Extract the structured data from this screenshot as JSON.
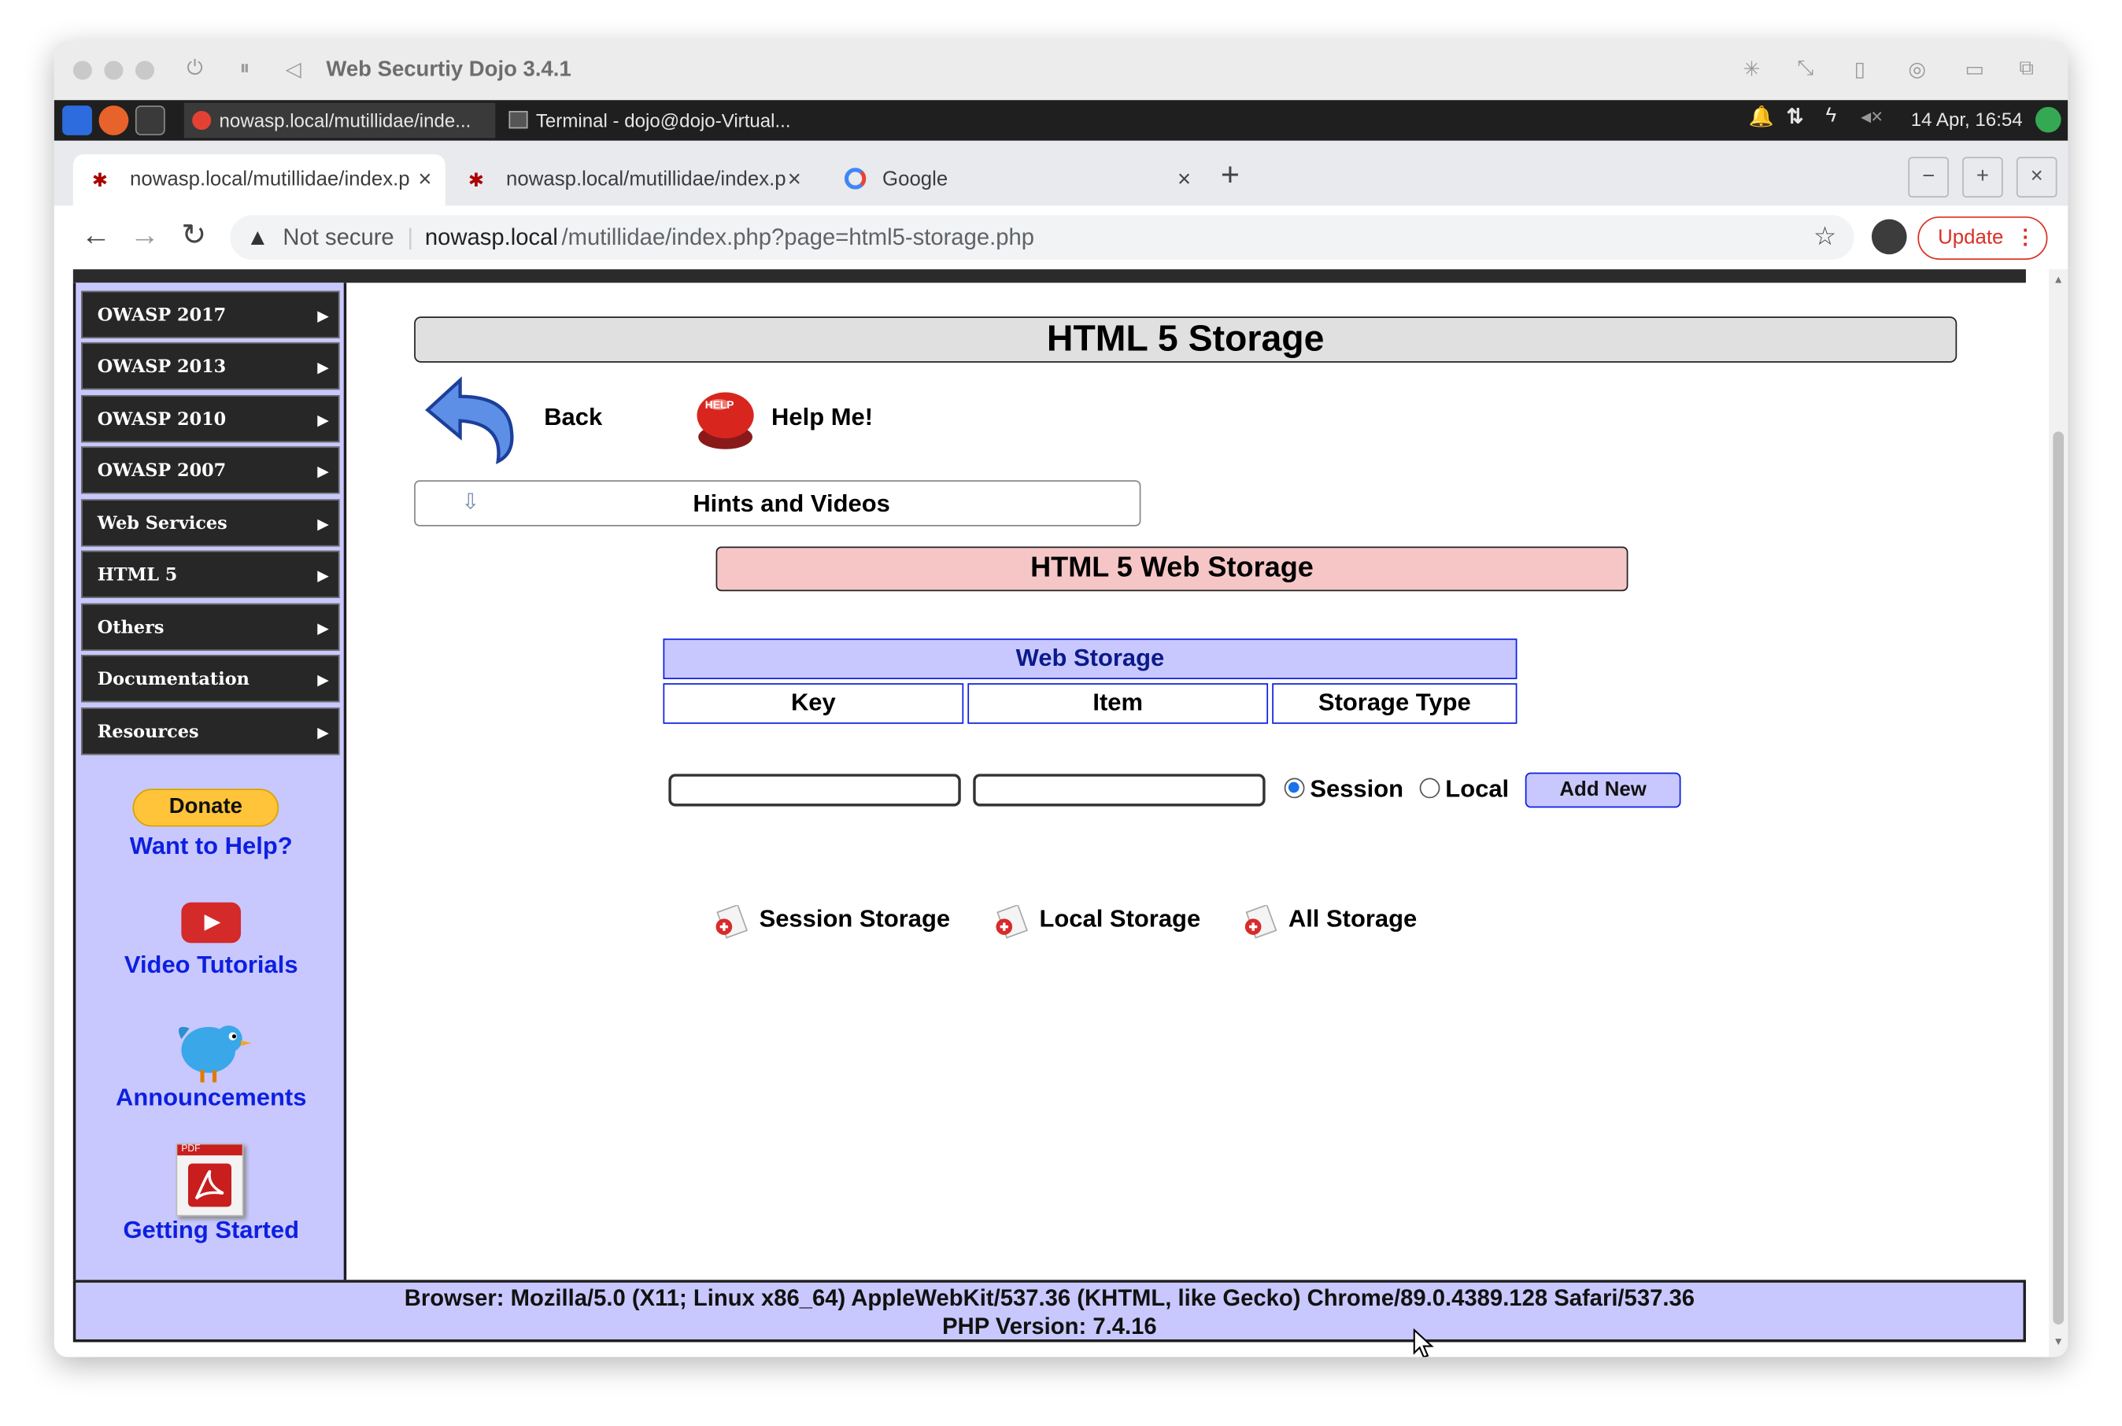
{
  "vm": {
    "title": "Web Securtiy Dojo 3.4.1",
    "controls": [
      "power-icon",
      "pause-icon",
      "back-icon"
    ],
    "right_icons": [
      "sparkle-icon",
      "resize-icon",
      "usb-icon",
      "camera-icon",
      "folder-icon",
      "window-icon"
    ]
  },
  "taskbar": {
    "tasks": [
      {
        "label": "nowasp.local/mutillidae/inde...",
        "active": true
      },
      {
        "label": "Terminal - dojo@dojo-Virtual...",
        "active": false
      }
    ],
    "clock": "14 Apr, 16:54"
  },
  "browser": {
    "tabs": [
      {
        "title": "nowasp.local/mutillidae/index.p",
        "active": true
      },
      {
        "title": "nowasp.local/mutillidae/index.p",
        "active": false
      },
      {
        "title": "Google",
        "active": false
      }
    ],
    "security_label": "Not secure",
    "url_host": "nowasp.local",
    "url_path": "/mutillidae/index.php?page=html5-storage.php",
    "update_label": "Update"
  },
  "sidebar": {
    "menu": [
      "OWASP 2017",
      "OWASP 2013",
      "OWASP 2010",
      "OWASP 2007",
      "Web Services",
      "HTML 5",
      "Others",
      "Documentation",
      "Resources"
    ],
    "donate_label": "Donate",
    "want_to_help": "Want to Help?",
    "video_tutorials": "Video Tutorials",
    "announcements": "Announcements",
    "getting_started": "Getting Started",
    "pdf_badge": "PDF"
  },
  "main": {
    "title": "HTML 5 Storage",
    "back_label": "Back",
    "help_label": "Help Me!",
    "help_badge": "HELP",
    "hints_label": "Hints and Videos",
    "subtitle": "HTML 5 Web Storage",
    "table_title": "Web Storage",
    "columns": [
      "Key",
      "Item",
      "Storage Type"
    ],
    "form": {
      "key_value": "",
      "item_value": "",
      "session_label": "Session",
      "local_label": "Local",
      "selected_type": "Session",
      "add_label": "Add New"
    },
    "storage_links": [
      "Session Storage",
      "Local Storage",
      "All Storage"
    ]
  },
  "footer": {
    "browser_line": "Browser: Mozilla/5.0 (X11; Linux x86_64) AppleWebKit/537.36 (KHTML, like Gecko) Chrome/89.0.4389.128 Safari/537.36",
    "php_line": "PHP Version: 7.4.16"
  }
}
